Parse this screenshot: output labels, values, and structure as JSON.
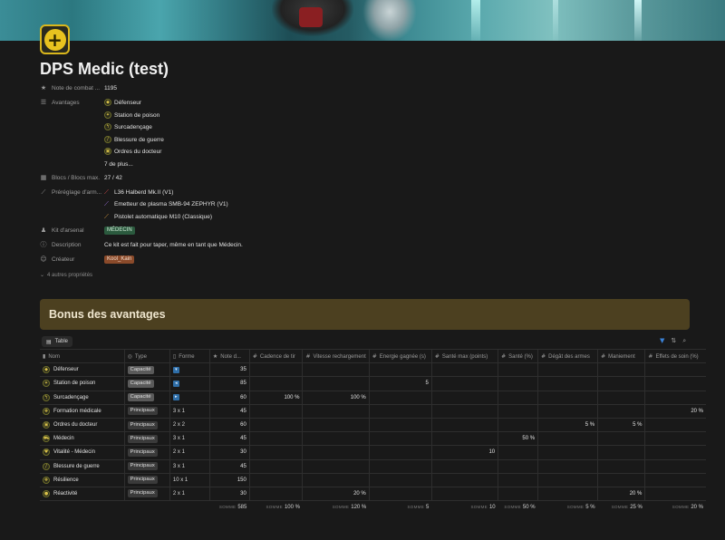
{
  "page": {
    "title": "DPS Medic (test)",
    "icon": "medic-plus-icon"
  },
  "properties": {
    "note_combat": {
      "key": "Note de combat ...",
      "value": "1195"
    },
    "avantages": {
      "key": "Avantages",
      "items": [
        "Défenseur",
        "Station de poison",
        "Surcadençage",
        "Blessure de guerre",
        "Ordres du docteur"
      ],
      "more": "7 de plus..."
    },
    "blocs": {
      "key": "Blocs / Blocs max.",
      "value": "27 / 42"
    },
    "prereglage": {
      "key": "Préréglage d'arm...",
      "items": [
        "L36 Halberd Mk.II (V1)",
        "Emetteur de plasma SMB-94 ZEPHYR (V1)",
        "Pistolet automatique M10 (Classique)"
      ]
    },
    "kit": {
      "key": "Kit d'arsenal",
      "value": "MÉDECIN"
    },
    "description": {
      "key": "Description",
      "value": "Ce kit est fait pour taper, même en tant que Médecin."
    },
    "createur": {
      "key": "Créateur",
      "value": "Kool_Kain"
    },
    "more_props": "4 autres propriétés"
  },
  "callout": {
    "title": "Bonus des avantages"
  },
  "view": {
    "tab_label": "Table"
  },
  "table": {
    "headers": [
      "Nom",
      "Type",
      "Forme",
      "Note d...",
      "Cadence de tir",
      "Vitesse rechargement",
      "Energie gagnée (s)",
      "Santé max (points)",
      "Santé (%)",
      "Dégât des armes",
      "Maniement",
      "Effets de soin (%)"
    ],
    "rows": [
      {
        "nom": "Défenseur",
        "type": "Capacité",
        "forme": "",
        "note": "35",
        "cadence": "",
        "vitesse": "",
        "energie": "",
        "sante_max": "",
        "sante": "",
        "degat": "",
        "maniement": "",
        "soin": ""
      },
      {
        "nom": "Station de poison",
        "type": "Capacité",
        "forme": "",
        "note": "85",
        "cadence": "",
        "vitesse": "",
        "energie": "5",
        "sante_max": "",
        "sante": "",
        "degat": "",
        "maniement": "",
        "soin": ""
      },
      {
        "nom": "Surcadençage",
        "type": "Capacité",
        "forme": "",
        "note": "60",
        "cadence": "100 %",
        "vitesse": "100 %",
        "energie": "",
        "sante_max": "",
        "sante": "",
        "degat": "",
        "maniement": "",
        "soin": ""
      },
      {
        "nom": "Formation médicale",
        "type": "Principaux",
        "forme": "3 x 1",
        "note": "45",
        "cadence": "",
        "vitesse": "",
        "energie": "",
        "sante_max": "",
        "sante": "",
        "degat": "",
        "maniement": "",
        "soin": "20 %"
      },
      {
        "nom": "Ordres du docteur",
        "type": "Principaux",
        "forme": "2 x 2",
        "note": "60",
        "cadence": "",
        "vitesse": "",
        "energie": "",
        "sante_max": "",
        "sante": "",
        "degat": "5 %",
        "maniement": "5 %",
        "soin": ""
      },
      {
        "nom": "Médecin",
        "type": "Principaux",
        "forme": "3 x 1",
        "note": "45",
        "cadence": "",
        "vitesse": "",
        "energie": "",
        "sante_max": "",
        "sante": "50 %",
        "degat": "",
        "maniement": "",
        "soin": ""
      },
      {
        "nom": "Vitalité - Médecin",
        "type": "Principaux",
        "forme": "2 x 1",
        "note": "30",
        "cadence": "",
        "vitesse": "",
        "energie": "",
        "sante_max": "10",
        "sante": "",
        "degat": "",
        "maniement": "",
        "soin": ""
      },
      {
        "nom": "Blessure de guerre",
        "type": "Principaux",
        "forme": "3 x 1",
        "note": "45",
        "cadence": "",
        "vitesse": "",
        "energie": "",
        "sante_max": "",
        "sante": "",
        "degat": "",
        "maniement": "",
        "soin": ""
      },
      {
        "nom": "Résilience",
        "type": "Principaux",
        "forme": "10 x 1",
        "note": "150",
        "cadence": "",
        "vitesse": "",
        "energie": "",
        "sante_max": "",
        "sante": "",
        "degat": "",
        "maniement": "",
        "soin": ""
      },
      {
        "nom": "Réactivité",
        "type": "Principaux",
        "forme": "2 x 1",
        "note": "30",
        "cadence": "",
        "vitesse": "20 %",
        "energie": "",
        "sante_max": "",
        "sante": "",
        "degat": "",
        "maniement": "20 %",
        "soin": ""
      }
    ],
    "footer": {
      "label": "SOMME",
      "note": "585",
      "cadence": "100 %",
      "vitesse": "120 %",
      "energie": "5",
      "sante_max": "10",
      "sante": "50 %",
      "degat": "5 %",
      "maniement": "25 %",
      "soin": "20 %"
    }
  },
  "colors": {
    "accent_yellow": "#e8c21f",
    "callout_bg": "#4c4020",
    "kit_tag": "#2b5a3e",
    "creator_tag": "#8a4a2a",
    "filter_blue": "#3b82d8"
  }
}
